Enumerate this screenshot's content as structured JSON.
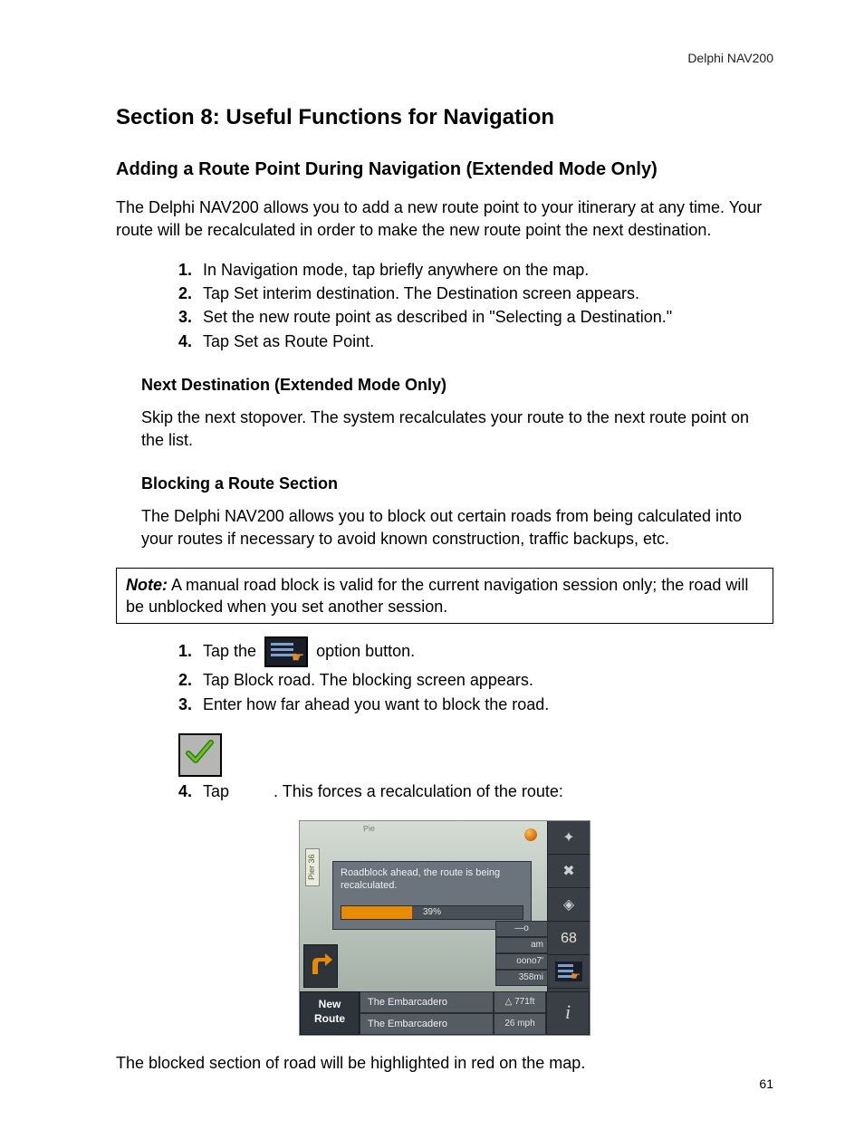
{
  "header": {
    "product": "Delphi NAV200"
  },
  "section": {
    "title": "Section 8:   Useful Functions for Navigation",
    "subtitle": "Adding a Route Point During Navigation (Extended Mode Only)",
    "intro": "The Delphi NAV200 allows you to add a new route point to your itinerary at any time. Your route will be recalculated in order to make the new route point the next destination.",
    "steps_a": [
      "In Navigation mode, tap briefly anywhere on the map.",
      "Tap Set interim destination. The Destination screen appears.",
      "Set the new route point as described in \"Selecting a Destination.\"",
      "Tap Set as Route Point."
    ],
    "next_dest": {
      "heading": "Next Destination (Extended Mode Only)",
      "body": "Skip the next stopover. The system recalculates your route to the next route point on the list."
    },
    "blocking": {
      "heading": "Blocking a Route Section",
      "body": "The Delphi NAV200 allows you to block out certain roads from being calculated into your routes if necessary to avoid known construction, traffic backups, etc."
    },
    "note": {
      "label": "Note:",
      "text": " A manual road block is valid for the current navigation session only; the road will be unblocked when you set another session."
    },
    "steps_b": {
      "s1_pre": "Tap the ",
      "s1_post": " option button.",
      "s2": "Tap Block road. The blocking screen appears.",
      "s3": "Enter how far ahead you want to block the road.",
      "s4_pre": "Tap ",
      "s4_post": ". This forces a recalculation of the route:"
    },
    "after_device": "The blocked section of road will be highlighted in red on the map."
  },
  "device": {
    "pier_label": "Pier 36",
    "top_street": "Pie",
    "dialog_msg": "Roadblock ahead, the route is being recalculated.",
    "progress_pct": "39%",
    "sidebar_label": "68",
    "info": {
      "am": "am",
      "dist": "358mi",
      "elev": "771ft",
      "odo": "oono7'"
    },
    "new_route_1": "New",
    "new_route_2": "Route",
    "street1": "The Embarcadero",
    "street2": "The Embarcadero",
    "speed": "26 mph"
  },
  "page_number": "61"
}
